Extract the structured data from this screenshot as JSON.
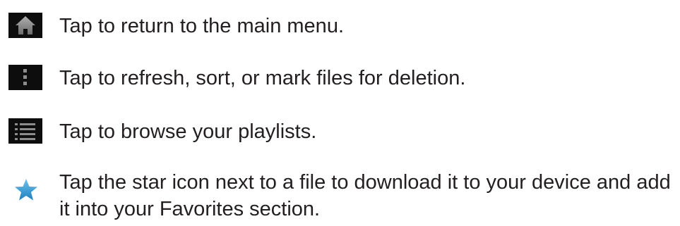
{
  "items": [
    {
      "icon": "home-icon",
      "text": "Tap to return to the main menu."
    },
    {
      "icon": "overflow-menu-icon",
      "text": "Tap to refresh, sort, or mark files for deletion."
    },
    {
      "icon": "list-icon",
      "text": "Tap to browse your playlists."
    },
    {
      "icon": "star-icon",
      "text_line1": "Tap the star icon next to a file to download it to your device and add",
      "text_line2": "it into your Favorites section."
    }
  ],
  "colors": {
    "icon_background": "#0d0d0d",
    "icon_glyph": "#8c8c8c",
    "star": "#3a9fd6",
    "text": "#231f20"
  }
}
